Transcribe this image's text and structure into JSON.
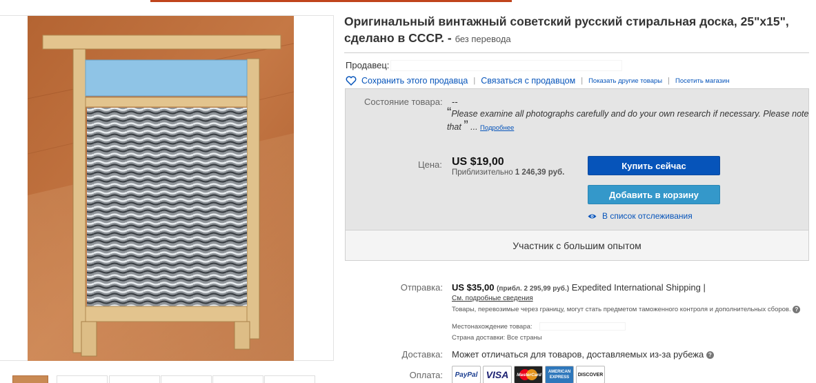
{
  "title": {
    "text": "Оригинальный винтажный советский русский стиральная доска, 25\"x15\", сделано в СССР. -",
    "no_translation": "без перевода"
  },
  "seller": {
    "label": "Продавец:",
    "save_link": "Сохранить этого продавца",
    "contact_link": "Связаться с продавцом",
    "other_items_link": "Показать другие товары",
    "store_link": "Посетить магазин"
  },
  "condition": {
    "label": "Состояние товара:",
    "value": "--",
    "quote": "Please examine all photographs carefully and do your own research if necessary. Please note that",
    "more_link": "Подробнее"
  },
  "price": {
    "label": "Цена:",
    "value": "US $19,00",
    "approx_prefix": "Приблизительно",
    "approx_value": "1 246,39 руб."
  },
  "actions": {
    "buy_now": "Купить сейчас",
    "add_to_cart": "Добавить в корзину",
    "watch": "В список отслеживания"
  },
  "seller_level": "Участник с большим опытом",
  "shipping": {
    "label": "Отправка:",
    "price": "US $35,00",
    "approx": "(прибл. 2 295,99 руб.)",
    "service": "Expedited International Shipping |",
    "details_link": "См. подробные сведения",
    "customs_note": "Товары, перевозимые через границу, могут стать предметом таможенного контроля и дополнительных сборов.",
    "location_label": "Местонахождение товара:",
    "country_text": "Страна доставки:  Все страны"
  },
  "delivery": {
    "label": "Доставка:",
    "value": "Может отличаться для товаров, доставляемых из-за рубежа"
  },
  "payment": {
    "label": "Оплата:",
    "methods": [
      "PayPal",
      "VISA",
      "MasterCard",
      "AMERICAN EXPRESS",
      "DISCOVER"
    ]
  },
  "icons": {
    "heart": "heart-icon",
    "eye": "eye-icon",
    "help": "help-icon"
  },
  "colors": {
    "link": "#0654ba",
    "buy_button": "#0654ba",
    "cart_button": "#3498ca"
  }
}
